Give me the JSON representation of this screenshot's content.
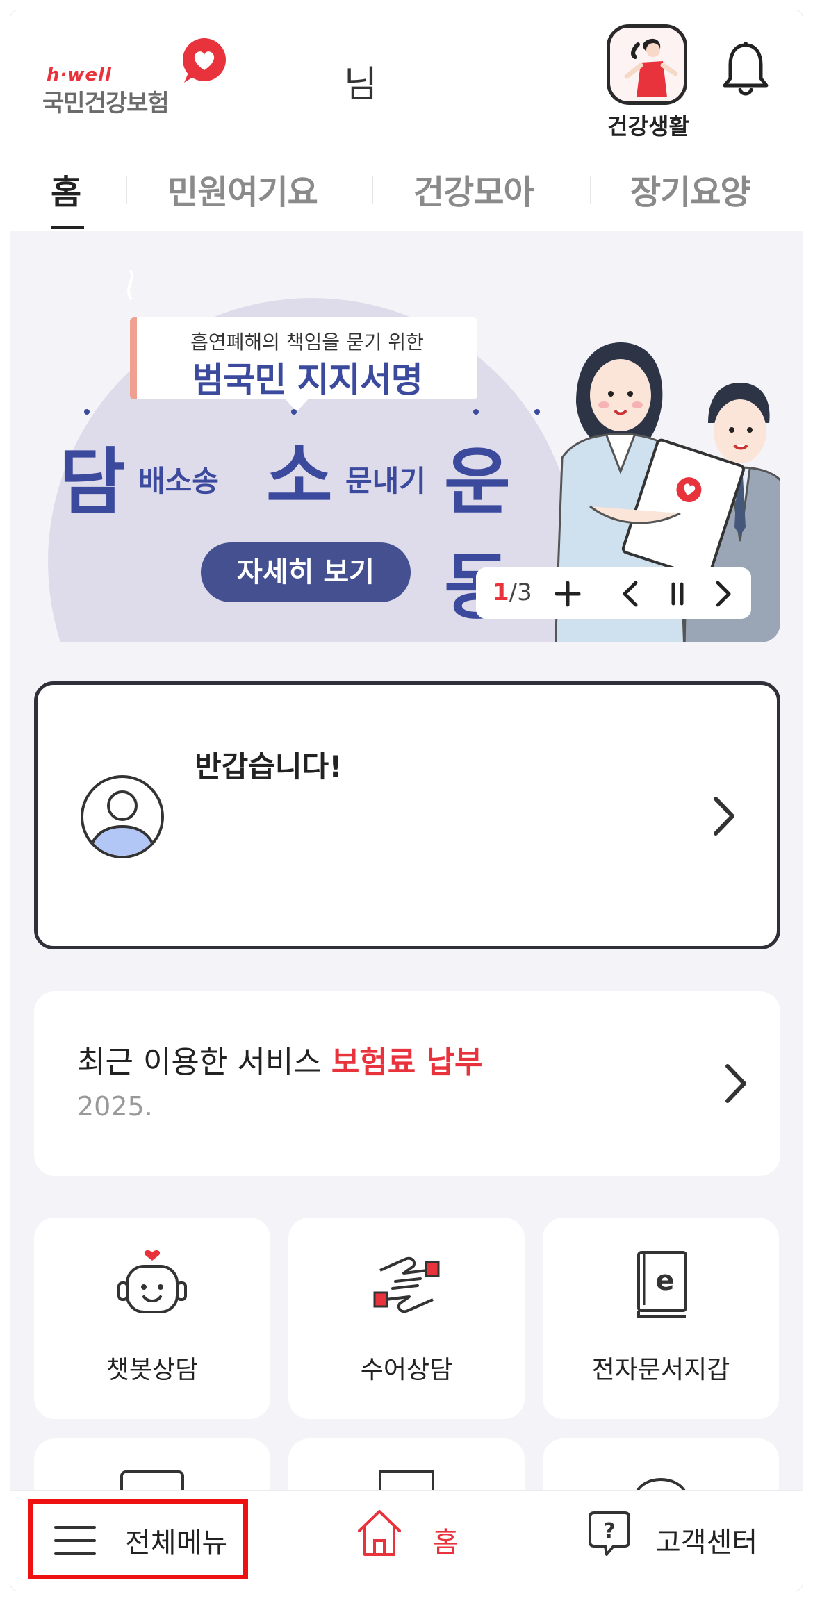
{
  "header": {
    "logo_small": "h·well",
    "logo_main": "국민건강보험",
    "user_name_suffix": "님",
    "health_life_label": "건강생활",
    "bell_icon": "bell-icon"
  },
  "tabs": [
    {
      "label": "홈",
      "active": true
    },
    {
      "label": "민원여기요",
      "active": false
    },
    {
      "label": "건강모아",
      "active": false
    },
    {
      "label": "장기요양",
      "active": false
    }
  ],
  "banner": {
    "sub_line": "흡연폐해의 책임을 묻기 위한",
    "main_line": "범국민 지지서명",
    "slogan": {
      "big1": "담",
      "small1": "배소송",
      "big2": "소",
      "small2": "문내기",
      "big3": "운동"
    },
    "detail_button": "자세히 보기",
    "pager": {
      "current": "1",
      "separator": "/",
      "total": "3"
    }
  },
  "profile": {
    "greeting": "반갑습니다!"
  },
  "recent": {
    "label": "최근 이용한 서비스 ",
    "service": "보험료 납부",
    "date": "2025."
  },
  "services": [
    {
      "label": "챗봇상담",
      "icon": "chatbot-icon"
    },
    {
      "label": "수어상담",
      "icon": "sign-language-icon"
    },
    {
      "label": "전자문서지갑",
      "icon": "e-document-icon"
    }
  ],
  "bottom_nav": {
    "menu": "전체메뉴",
    "home": "홈",
    "help": "고객센터"
  },
  "colors": {
    "accent_red": "#e8333d",
    "banner_blue": "#3c4a9e",
    "background": "#f3f3f8"
  }
}
